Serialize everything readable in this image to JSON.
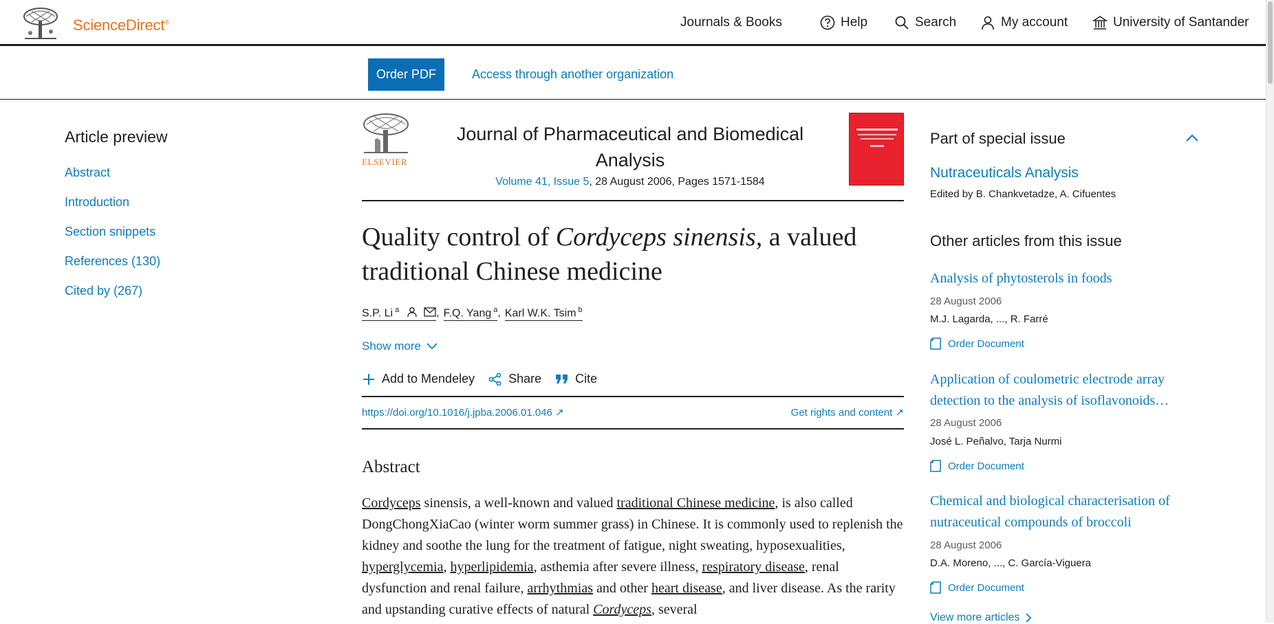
{
  "header": {
    "brand": "ScienceDirect",
    "brand_mark": "®",
    "nav": {
      "journals": "Journals & Books",
      "help": "Help",
      "search": "Search",
      "account": "My account",
      "institution": "University of Santander"
    }
  },
  "access": {
    "order_pdf": "Order PDF",
    "access_other": "Access through another organization"
  },
  "toc": {
    "title": "Article preview",
    "items": [
      "Abstract",
      "Introduction",
      "Section snippets",
      "References (130)",
      "Cited by (267)"
    ]
  },
  "journal": {
    "publisher": "ELSEVIER",
    "name": "Journal of Pharmaceutical and Biomedical Analysis",
    "volume_link": "Volume 41, Issue 5",
    "volume_rest": ", 28 August 2006, Pages 1571-1584"
  },
  "article": {
    "title_part1": "Quality control of ",
    "title_italic": "Cordyceps sinensis",
    "title_part2": ", a valued traditional Chinese medicine",
    "authors": [
      {
        "name": "S.P. Li",
        "sup": "a"
      },
      {
        "name": "F.Q. Yang",
        "sup": "a"
      },
      {
        "name": "Karl W.K. Tsim",
        "sup": "b"
      }
    ],
    "show_more": "Show more",
    "actions": {
      "mendeley": "Add to Mendeley",
      "share": "Share",
      "cite": "Cite"
    },
    "doi": "https://doi.org/10.1016/j.jpba.2006.01.046",
    "rights": "Get rights and content",
    "abstract_heading": "Abstract",
    "abstract": {
      "w1": "Cordyceps",
      "t1": " sinensis, a well-known and valued ",
      "w2": "traditional Chinese medicine",
      "t2": ", is also called DongChongXiaCao (winter worm summer grass) in Chinese. It is commonly used to replenish the kidney and soothe the lung for the treatment of fatigue, night sweating, hyposexualities, ",
      "w3": "hyperglycemia",
      "t3": ", ",
      "w4": "hyperlipidemia",
      "t4": ", asthemia after severe illness, ",
      "w5": "respiratory disease",
      "t5": ", renal dysfunction and renal failure, ",
      "w6": "arrhythmias",
      "t6": " and other ",
      "w7": "heart disease",
      "t7": ", and liver disease. As the rarity and upstanding curative effects of natural ",
      "w8": "Cordyceps",
      "t8": ", several"
    }
  },
  "sidebar": {
    "special_issue_title": "Part of special issue",
    "special_issue_link": "Nutraceuticals Analysis",
    "edited_by": "Edited by B. Chankvetadze, A. Cifuentes",
    "other_title": "Other articles from this issue",
    "articles": [
      {
        "title": "Analysis of phytosterols in foods",
        "date": "28 August 2006",
        "authors": "M.J. Lagarda, ..., R. Farré",
        "order": "Order Document"
      },
      {
        "title": "Application of coulometric electrode array detection to the analysis of isoflavonoids…",
        "date": "28 August 2006",
        "authors": "José L. Peñalvo, Tarja Nurmi",
        "order": "Order Document"
      },
      {
        "title": "Chemical and biological characterisation of nutraceutical compounds of broccoli",
        "date": "28 August 2006",
        "authors": "D.A. Moreno, ..., C. García-Viguera",
        "order": "Order Document"
      }
    ],
    "view_more": "View more articles"
  },
  "colors": {
    "brand": "#e9711c",
    "link": "#0c7dbb",
    "button": "#0a6eb4",
    "cover": "#e8212e"
  }
}
